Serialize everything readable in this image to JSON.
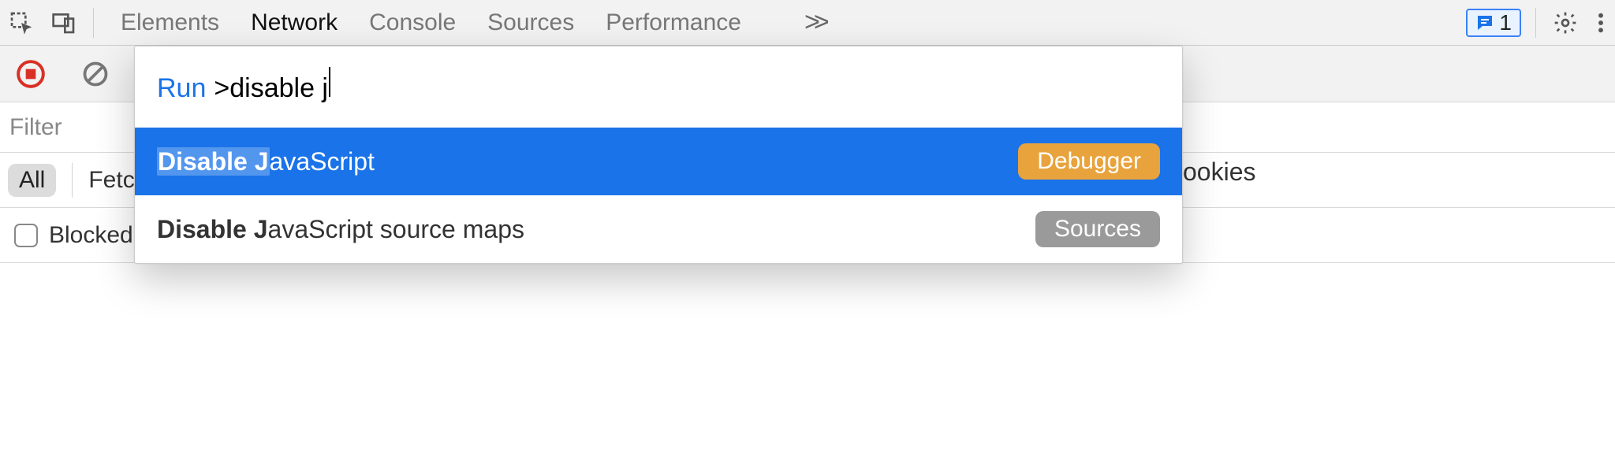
{
  "topbar": {
    "tabs": [
      "Elements",
      "Network",
      "Console",
      "Sources",
      "Performance"
    ],
    "active_tab_index": 1,
    "overflow_glyph": ">>",
    "issues_count": "1"
  },
  "filter": {
    "placeholder": "Filter",
    "all_pill": "All",
    "fetch_label": "Fetch",
    "cookies_label": "ookies"
  },
  "blocked": {
    "label": "Blocked"
  },
  "palette": {
    "run_label": "Run",
    "prefix": ">",
    "query": "disable j",
    "items": [
      {
        "match": "Disable J",
        "rest": "avaScript",
        "badge": "Debugger",
        "selected": true
      },
      {
        "match": "Disable J",
        "rest": "avaScript source maps",
        "badge": "Sources",
        "selected": false
      }
    ]
  }
}
